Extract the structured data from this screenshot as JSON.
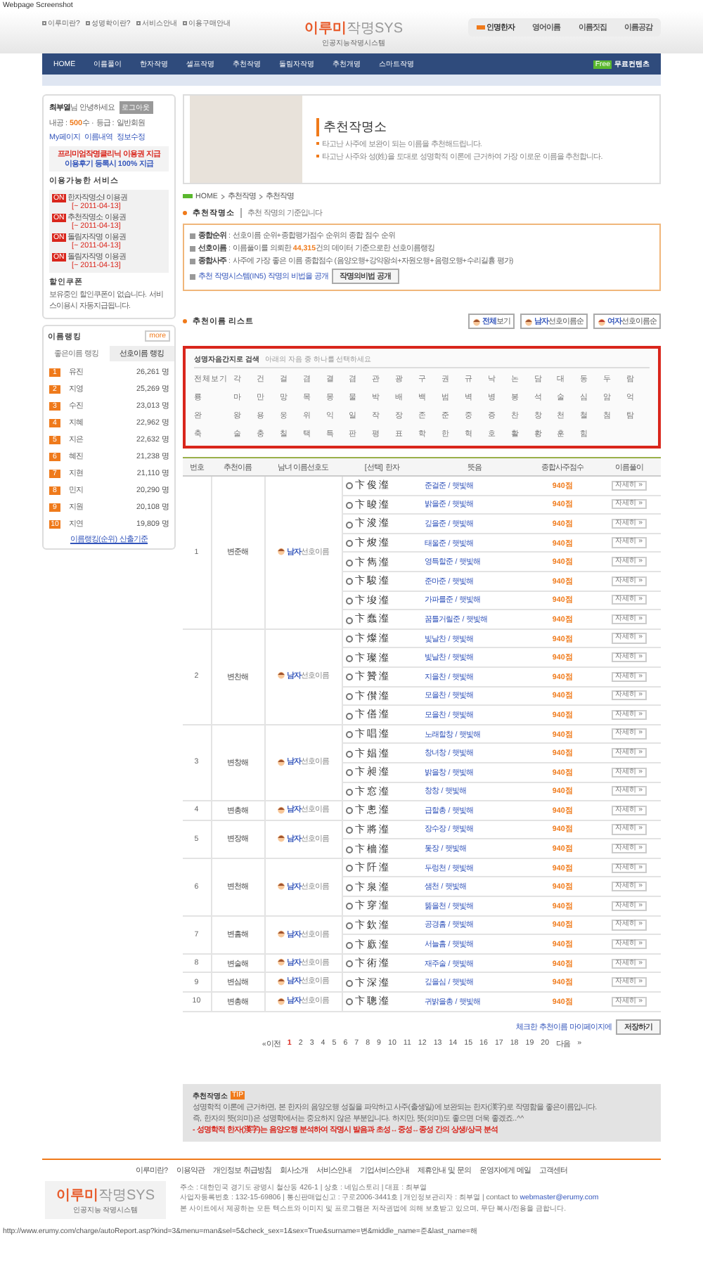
{
  "caption": "Webpage Screenshot",
  "top_links": [
    "이루미란?",
    "성명학이란?",
    "서비스안내",
    "이용구매안내"
  ],
  "logo": {
    "name": "이루미",
    "suffix": "작명SYS",
    "tagline": "인공지능작명시스템"
  },
  "footer_logo": {
    "name": "이루미",
    "suffix": "작명SYS",
    "tagline": "인공지능 작명시스템"
  },
  "top_menu": [
    {
      "label": "인명한자",
      "selected": true
    },
    {
      "label": "영어이름",
      "selected": false
    },
    {
      "label": "이름짓집",
      "selected": false
    },
    {
      "label": "이름공감",
      "selected": false
    }
  ],
  "nav": {
    "items": [
      "HOME",
      "이름풀이",
      "한자작명",
      "셀프작명",
      "추천작명",
      "돌림자작명",
      "추천개명",
      "스마트작명"
    ],
    "free_badge": "Free",
    "free_label": "무료컨텐츠"
  },
  "user_box": {
    "name": "최부열",
    "greeting": "님 안녕하세요",
    "logout": "로그아웃",
    "stats": "내공 : **500**수 · 등급 : 일반회원",
    "links": [
      "My페이지",
      "이름내역",
      "정보수정"
    ],
    "promo": [
      "프리미엄작명클리닉 이용권 지급",
      "이용후기 등록시 100% 지급"
    ]
  },
  "services": {
    "title": "이용가능한 서비스",
    "items": [
      {
        "badge": "ON",
        "name": "한자작명소Ⅰ 이용권",
        "date": "[~ 2011-04-13]"
      },
      {
        "badge": "ON",
        "name": "추천작명소 이용권",
        "date": "[~ 2011-04-13]"
      },
      {
        "badge": "ON",
        "name": "돌림자작명 이용권",
        "date": "[~ 2011-04-13]"
      },
      {
        "badge": "ON",
        "name": "돌림자작명 이용권",
        "date": "[~ 2011-04-13]"
      }
    ]
  },
  "coupon": {
    "title": "할인쿠폰",
    "text": "보유중인 할인쿠폰이 없습니다. 서비스이용시 자동지급됩니다."
  },
  "ranking": {
    "title": "이름랭킹",
    "more": "more",
    "tabs": [
      {
        "label": "좋은이름 랭킹",
        "selected": false
      },
      {
        "label": "선호이름 랭킹",
        "selected": true
      }
    ],
    "rows": [
      {
        "rank": "1",
        "name": "유진",
        "count": "26,261 명"
      },
      {
        "rank": "2",
        "name": "지영",
        "count": "25,269 명"
      },
      {
        "rank": "3",
        "name": "수진",
        "count": "23,013 명"
      },
      {
        "rank": "4",
        "name": "지혜",
        "count": "22,962 명"
      },
      {
        "rank": "5",
        "name": "지은",
        "count": "22,632 명"
      },
      {
        "rank": "6",
        "name": "혜진",
        "count": "21,238 명"
      },
      {
        "rank": "7",
        "name": "지현",
        "count": "21,110 명"
      },
      {
        "rank": "8",
        "name": "민지",
        "count": "20,290 명"
      },
      {
        "rank": "9",
        "name": "지원",
        "count": "20,108 명"
      },
      {
        "rank": "10",
        "name": "지연",
        "count": "19,809 명"
      }
    ],
    "footer": "이름랭킹(순위) 산출기준"
  },
  "banner": {
    "title": "추천작명소",
    "lines": [
      "타고난 사주에 보완이 되는 이름을 추천해드립니다.",
      "타고난 사주와 성(姓)을 토대로 성명학적 이론에 근거하여 가장 이로운 이름을 추천합니다."
    ]
  },
  "breadcrumb": [
    "HOME",
    "추천작명",
    "추천작명"
  ],
  "section": {
    "title": "추천작명소",
    "subtitle": "추천 작명의 기준입니다"
  },
  "info": {
    "lines": [
      {
        "label": "종합순위",
        "text": ": 선호이름 순위+종합평가점수 순위의 종합 점수 순위"
      },
      {
        "label": "선호이름",
        "text": ": 이름풀이를 의뢰한 **44,315**건의 데이터 기준으로한 선호이름랭킹"
      },
      {
        "label": "종합사주",
        "text": ": 사주에 가장 좋은 이름 종합점수 (음양오행+강약왕쇠+자원오행+음령오행+수리길흉 평가)"
      }
    ],
    "secret_link": "추천 작명시스템(IN5) 작명의 비법을 공개",
    "secret_button": "작명의비법 공개"
  },
  "list": {
    "title": "추천이름 리스트",
    "views": [
      "**전체**보기",
      "**남자**선호이름순",
      "**여자**선호이름순"
    ]
  },
  "search": {
    "title": "성명자음간지로 검색",
    "hint": "아래의 자음 중 하나를 선택하세요",
    "letters": [
      "전체보기",
      "각",
      "건",
      "걸",
      "겸",
      "결",
      "겸",
      "관",
      "광",
      "구",
      "권",
      "규",
      "낙",
      "논",
      "담",
      "대",
      "동",
      "두",
      "람",
      "룡",
      "마",
      "만",
      "망",
      "목",
      "몽",
      "물",
      "박",
      "배",
      "백",
      "범",
      "벽",
      "병",
      "봉",
      "석",
      "술",
      "심",
      "암",
      "억",
      "완",
      "왕",
      "용",
      "웅",
      "위",
      "익",
      "일",
      "작",
      "장",
      "존",
      "준",
      "중",
      "증",
      "찬",
      "창",
      "천",
      "철",
      "첨",
      "탐",
      "축",
      "술",
      "충",
      "칠",
      "택",
      "특",
      "판",
      "평",
      "표",
      "학",
      "한",
      "혁",
      "호",
      "활",
      "황",
      "훈",
      "힘"
    ]
  },
  "table": {
    "columns": [
      "번호",
      "추천이름",
      "남녀 이름선호도",
      "[선택] 한자",
      "뜻음",
      "종합사주점수",
      "이름풀이"
    ],
    "groups": [
      {
        "no": "1",
        "name": "변준해",
        "pref": "**남자**선호이름",
        "rows": [
          {
            "checked": false,
            "hanja": "卞俊瀣",
            "meaning": "준걸준 / 햇빛해",
            "score": "940점",
            "detail": "자세히 »"
          },
          {
            "checked": false,
            "hanja": "卞晙瀣",
            "meaning": "밝을준 / 햇빛해",
            "score": "940점",
            "detail": "자세히 »"
          },
          {
            "checked": false,
            "hanja": "卞浚瀣",
            "meaning": "깊을준 / 햇빛해",
            "score": "940점",
            "detail": "자세히 »"
          },
          {
            "checked": false,
            "hanja": "卞焌瀣",
            "meaning": "태울준 / 햇빛해",
            "score": "940점",
            "detail": "자세히 »"
          },
          {
            "checked": false,
            "hanja": "卞雋瀣",
            "meaning": "영특할준 / 햇빛해",
            "score": "940점",
            "detail": "자세히 »"
          },
          {
            "checked": false,
            "hanja": "卞駿瀣",
            "meaning": "준마준 / 햇빛해",
            "score": "940점",
            "detail": "자세히 »"
          },
          {
            "checked": false,
            "hanja": "卞埈瀣",
            "meaning": "가파를준 / 햇빛해",
            "score": "940점",
            "detail": "자세히 »"
          },
          {
            "checked": false,
            "hanja": "卞蠢瀣",
            "meaning": "꿈틀거릴준 / 햇빛해",
            "score": "940점",
            "detail": "자세히 »"
          }
        ]
      },
      {
        "no": "2",
        "name": "변찬해",
        "pref": "**남자**선호이름",
        "rows": [
          {
            "checked": false,
            "hanja": "卞燦瀣",
            "meaning": "빛날찬 / 햇빛해",
            "score": "940점",
            "detail": "자세히 »"
          },
          {
            "checked": false,
            "hanja": "卞璨瀣",
            "meaning": "빛날찬 / 햇빛해",
            "score": "940점",
            "detail": "자세히 »"
          },
          {
            "checked": false,
            "hanja": "卞贊瀣",
            "meaning": "지을찬 / 햇빛해",
            "score": "940점",
            "detail": "자세히 »"
          },
          {
            "checked": false,
            "hanja": "卞儧瀣",
            "meaning": "모을찬 / 햇빛해",
            "score": "940점",
            "detail": "자세히 »"
          },
          {
            "checked": false,
            "hanja": "卞僐瀣",
            "meaning": "모을찬 / 햇빛해",
            "score": "940점",
            "detail": "자세히 »"
          }
        ]
      },
      {
        "no": "3",
        "name": "변창해",
        "pref": "**남자**선호이름",
        "rows": [
          {
            "checked": false,
            "hanja": "卞唱瀣",
            "meaning": "노래할창 / 햇빛해",
            "score": "940점",
            "detail": "자세히 »"
          },
          {
            "checked": false,
            "hanja": "卞娼瀣",
            "meaning": "창녀창 / 햇빛해",
            "score": "940점",
            "detail": "자세히 »"
          },
          {
            "checked": false,
            "hanja": "卞昶瀣",
            "meaning": "밝을창 / 햇빛해",
            "score": "940점",
            "detail": "자세히 »"
          },
          {
            "checked": false,
            "hanja": "卞窓瀣",
            "meaning": "창창 / 햇빛해",
            "score": "940점",
            "detail": "자세히 »"
          }
        ]
      },
      {
        "no": "4",
        "name": "변총해",
        "pref": "**남자**선호이름",
        "rows": [
          {
            "checked": false,
            "hanja": "卞悤瀣",
            "meaning": "급할총 / 햇빛해",
            "score": "940점",
            "detail": "자세히 »"
          }
        ]
      },
      {
        "no": "5",
        "name": "변장해",
        "pref": "**남자**선호이름",
        "rows": [
          {
            "checked": false,
            "hanja": "卞將瀣",
            "meaning": "장수장 / 햇빛해",
            "score": "940점",
            "detail": "자세히 »"
          },
          {
            "checked": false,
            "hanja": "卞檣瀣",
            "meaning": "돛장 / 햇빛해",
            "score": "940점",
            "detail": "자세히 »"
          }
        ]
      },
      {
        "no": "6",
        "name": "변천해",
        "pref": "**남자**선호이름",
        "rows": [
          {
            "checked": false,
            "hanja": "卞阡瀣",
            "meaning": "두렁천 / 햇빛해",
            "score": "940점",
            "detail": "자세히 »"
          },
          {
            "checked": false,
            "hanja": "卞泉瀣",
            "meaning": "샘천 / 햇빛해",
            "score": "940점",
            "detail": "자세히 »"
          },
          {
            "checked": false,
            "hanja": "卞穿瀣",
            "meaning": "뚫을천 / 햇빛해",
            "score": "940점",
            "detail": "자세히 »"
          }
        ]
      },
      {
        "no": "7",
        "name": "변흠해",
        "pref": "**남자**선호이름",
        "rows": [
          {
            "checked": false,
            "hanja": "卞欽瀣",
            "meaning": "공경흠 / 햇빛해",
            "score": "940점",
            "detail": "자세히 »"
          },
          {
            "checked": false,
            "hanja": "卞廞瀣",
            "meaning": "서늘흠 / 햇빛해",
            "score": "940점",
            "detail": "자세히 »"
          }
        ]
      },
      {
        "no": "8",
        "name": "변술해",
        "pref": "**남자**선호이름",
        "rows": [
          {
            "checked": false,
            "hanja": "卞術瀣",
            "meaning": "재주술 / 햇빛해",
            "score": "940점",
            "detail": "자세히 »"
          }
        ]
      },
      {
        "no": "9",
        "name": "변심해",
        "pref": "**남자**선호이름",
        "rows": [
          {
            "checked": false,
            "hanja": "卞深瀣",
            "meaning": "깊을심 / 햇빛해",
            "score": "940점",
            "detail": "자세히 »"
          }
        ]
      },
      {
        "no": "10",
        "name": "변총해",
        "pref": "**남자**선호이름",
        "rows": [
          {
            "checked": false,
            "hanja": "卞聰瀣",
            "meaning": "귀밝을총 / 햇빛해",
            "score": "940점",
            "detail": "자세히 »"
          }
        ]
      }
    ]
  },
  "save": {
    "text": "체크한 추천이름 마이페이지에",
    "button": "저장하기"
  },
  "pagination": {
    "prev": "«이전",
    "pages": [
      {
        "label": "1",
        "selected": true
      },
      {
        "label": "2",
        "selected": false
      },
      {
        "label": "3",
        "selected": false
      },
      {
        "label": "4",
        "selected": false
      },
      {
        "label": "5",
        "selected": false
      },
      {
        "label": "6",
        "selected": false
      },
      {
        "label": "7",
        "selected": false
      },
      {
        "label": "8",
        "selected": false
      },
      {
        "label": "9",
        "selected": false
      },
      {
        "label": "10",
        "selected": false
      },
      {
        "label": "11",
        "selected": false
      },
      {
        "label": "12",
        "selected": false
      },
      {
        "label": "13",
        "selected": false
      },
      {
        "label": "14",
        "selected": false
      },
      {
        "label": "15",
        "selected": false
      },
      {
        "label": "16",
        "selected": false
      },
      {
        "label": "17",
        "selected": false
      },
      {
        "label": "18",
        "selected": false
      },
      {
        "label": "19",
        "selected": false
      },
      {
        "label": "20",
        "selected": false
      }
    ],
    "next": "다음",
    "last": "»"
  },
  "notice": {
    "title": "추천작명소",
    "badge": "TIP",
    "lines": [
      "성명학적 이론에 근거하면, 본 한자의 음양오행 성질을 파악하고 사주(출생일)에 보완되는 한자(漢字)로 작명함을 좋은이름입니다.",
      "즉, 한자의 뜻(의미)은 성명학에서는 중요하지 않은 부분입니다. 하지만, 뜻(의미)도 좋으면 더욱 좋겠죠..^^"
    ],
    "warning": "- 성명학적 한자(漢字)는 음양오행 분석하여 작명시 발음과 초성↔중성↔종성 간의 상생/상극 분석"
  },
  "footer": {
    "links": [
      "이루미란?",
      "이용약관",
      "개인정보 취급방침",
      "회사소개",
      "서비스안내",
      "기업서비스안내",
      "제휴안내 및 문의",
      "운영자에게 메일",
      "고객센터"
    ],
    "address": [
      "주소 : 대한민국 경기도 광명시 철산동 426-1 | 상호 : 네임스토리 | 대표 : 최부열",
      "사업자등록번호 : 132-15-69806 | 통신판매업신고 : 구로2006-3441호 | 개인정보관리자 : 최부열 | contact to",
      "본 사이트에서 제공하는 모든 텍스트와 이미지 및 프로그램은 저작권법에 의해 보호받고 있으며, 무단 복사/전용을 금합니다."
    ],
    "email": "webmaster@erumy.com"
  },
  "url": "http://www.erumy.com/charge/autoReport.asp?kind=3&menu=man&sel=5&check_sex=1&sex=True&surname=변&middle_name=준&last_name=해"
}
